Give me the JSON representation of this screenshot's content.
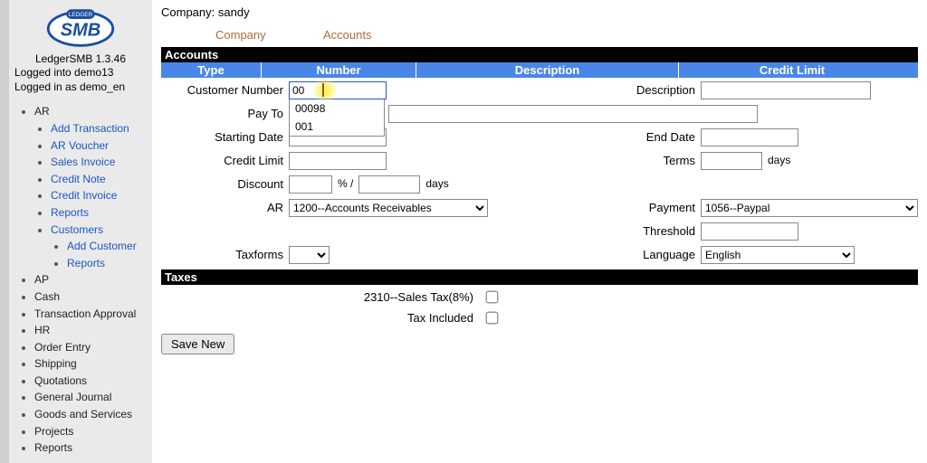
{
  "app": {
    "title": "LedgerSMB 1.3.46",
    "login_db": "Logged into demo13",
    "login_user": "Logged in as demo_en",
    "logo_pill": "LEDGER",
    "logo_main": "SMB"
  },
  "nav": {
    "ar": "AR",
    "ar_items": [
      "Add Transaction",
      "AR Voucher",
      "Sales Invoice",
      "Credit Note",
      "Credit Invoice",
      "Reports",
      "Customers"
    ],
    "ar_cust": [
      "Add Customer",
      "Reports"
    ],
    "rest": [
      "AP",
      "Cash",
      "Transaction Approval",
      "HR",
      "Order Entry",
      "Shipping",
      "Quotations",
      "General Journal",
      "Goods and Services",
      "Projects",
      "Reports"
    ]
  },
  "header": {
    "company_label": "Company:",
    "company_value": "sandy",
    "tab_company": "Company",
    "tab_accounts": "Accounts"
  },
  "section": {
    "accounts": "Accounts",
    "taxes": "Taxes"
  },
  "cols": {
    "type": "Type",
    "number": "Number",
    "description": "Description",
    "credit_limit": "Credit Limit"
  },
  "labels": {
    "cust_no": "Customer Number",
    "description": "Description",
    "pay_to": "Pay To",
    "starting_date": "Starting Date",
    "end_date": "End Date",
    "credit_limit": "Credit Limit",
    "terms": "Terms",
    "days": "days",
    "discount": "Discount",
    "pct_sep": "% /",
    "ar": "AR",
    "payment": "Payment",
    "threshold": "Threshold",
    "taxforms": "Taxforms",
    "language": "Language"
  },
  "values": {
    "cust_no_input": "00",
    "autocomplete": [
      "00098",
      "001"
    ],
    "ar_select": "1200--Accounts Receivables",
    "payment_select": "1056--Paypal",
    "language_select": "English"
  },
  "taxes": {
    "line1": "2310--Sales Tax(8%)",
    "line2": "Tax Included"
  },
  "buttons": {
    "save_new": "Save New"
  }
}
